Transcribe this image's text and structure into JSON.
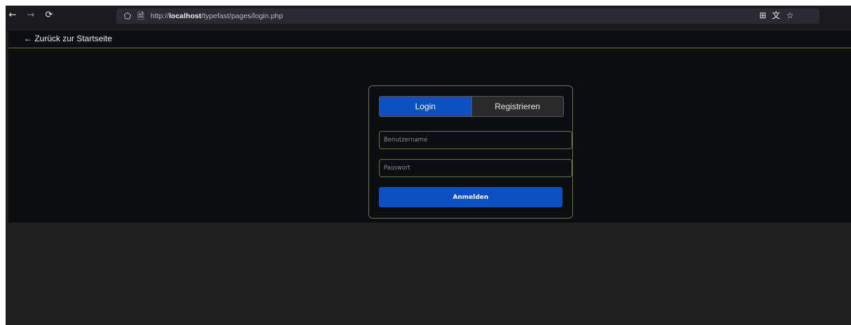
{
  "browser": {
    "url_prefix": "http://",
    "url_host": "localhost",
    "url_path": "/typefast/pages/login.php",
    "icons": {
      "back": "back-arrow-icon",
      "forward": "forward-arrow-icon",
      "reload": "reload-icon",
      "shield": "tracking-protection-shield-icon",
      "page": "page-info-icon",
      "reader": "reader-view-icon",
      "translate": "translate-icon",
      "bookmark": "bookmark-star-icon"
    }
  },
  "page": {
    "back_link": "← Zurück zur Startseite",
    "login_form": {
      "tabs": [
        {
          "label": "Login",
          "active": true
        },
        {
          "label": "Registrieren",
          "active": false
        }
      ],
      "username_placeholder": "Benutzername",
      "password_placeholder": "Passwort",
      "submit_label": "Anmelden"
    }
  },
  "colors": {
    "accent_blue": "#0b4fc0",
    "border_olive": "#6b7445",
    "page_bg": "#0c0d10"
  }
}
